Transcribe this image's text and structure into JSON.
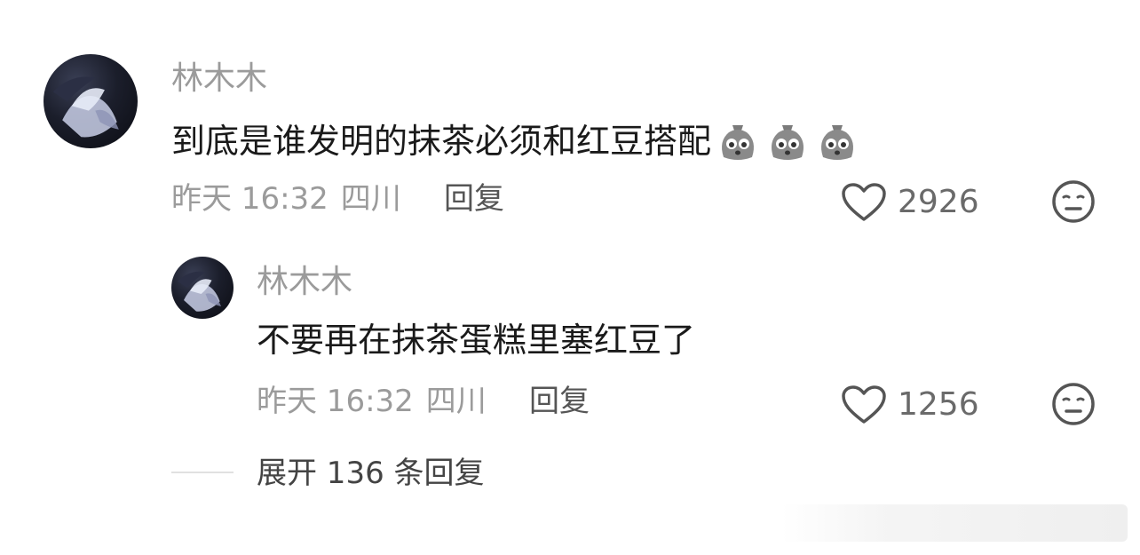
{
  "comment": {
    "username": "林木木",
    "text": "到底是谁发明的抹茶必须和红豆搭配",
    "emojis": [
      "crying-bag-emoji",
      "crying-bag-emoji",
      "crying-bag-emoji"
    ],
    "time": "昨天 16:32",
    "location": "四川",
    "reply_label": "回复",
    "like_count": "2926",
    "icons": {
      "like": "heart-outline-icon",
      "dislike": "neutral-face-icon"
    }
  },
  "reply": {
    "username": "林木木",
    "text": "不要再在抹茶蛋糕里塞红豆了",
    "time": "昨天 16:32",
    "location": "四川",
    "reply_label": "回复",
    "like_count": "1256",
    "icons": {
      "like": "heart-outline-icon",
      "dislike": "neutral-face-icon"
    }
  },
  "expand_replies": "展开 136 条回复"
}
